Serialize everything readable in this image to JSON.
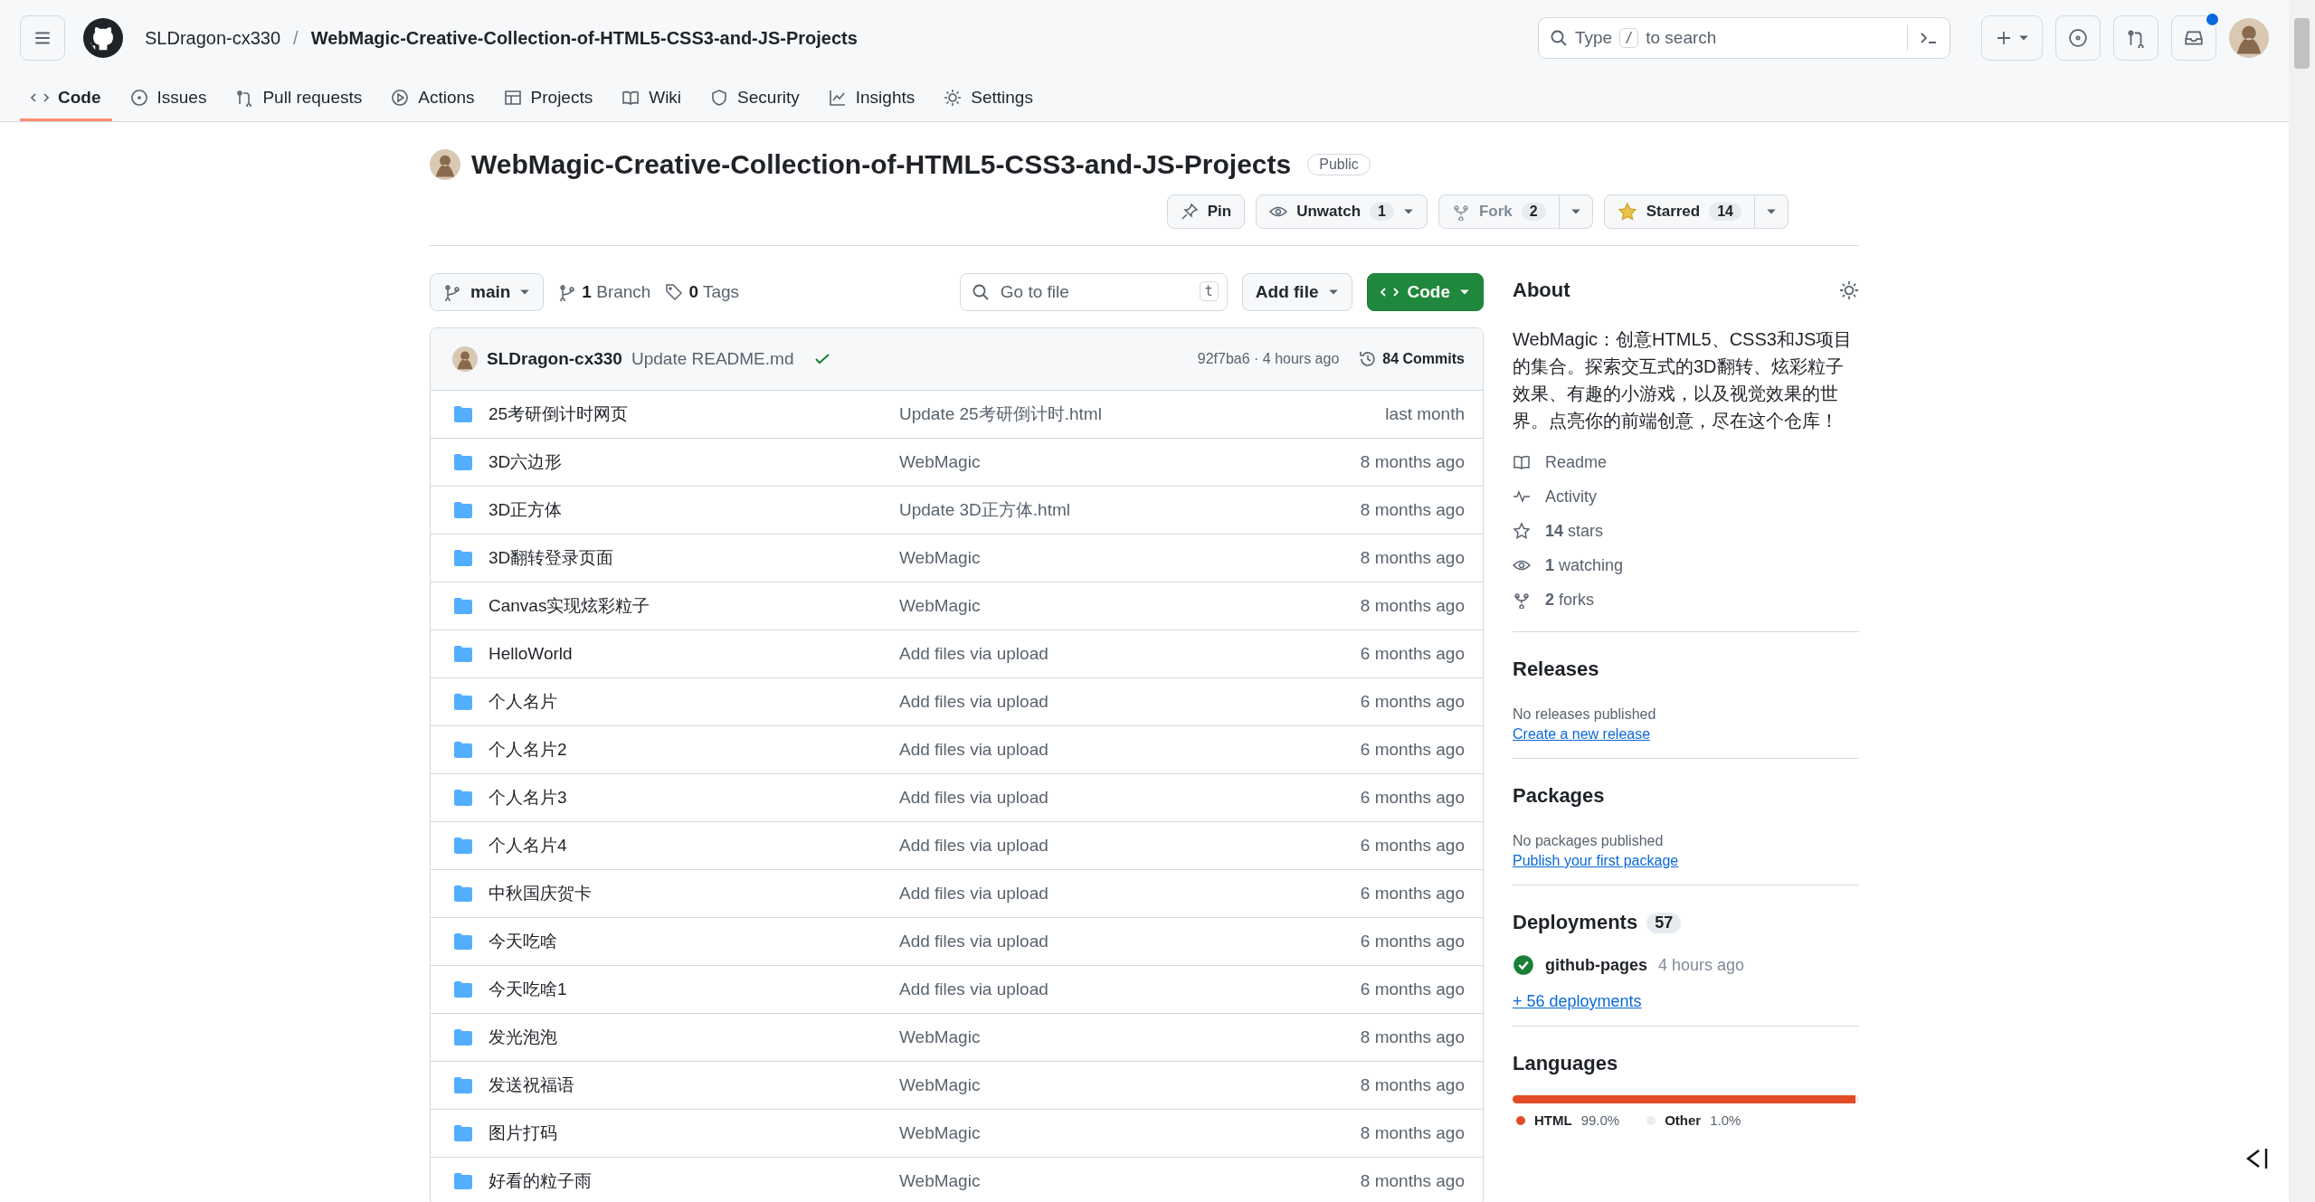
{
  "header": {
    "owner": "SLDragon-cx330",
    "separator": "/",
    "repo": "WebMagic-Creative-Collection-of-HTML5-CSS3-and-JS-Projects",
    "search": {
      "before": "Type",
      "key": "/",
      "after": "to search"
    },
    "inbox_unread": true
  },
  "tabs": [
    {
      "label": "Code",
      "selected": true
    },
    {
      "label": "Issues",
      "selected": false
    },
    {
      "label": "Pull requests",
      "selected": false
    },
    {
      "label": "Actions",
      "selected": false
    },
    {
      "label": "Projects",
      "selected": false
    },
    {
      "label": "Wiki",
      "selected": false
    },
    {
      "label": "Security",
      "selected": false
    },
    {
      "label": "Insights",
      "selected": false
    },
    {
      "label": "Settings",
      "selected": false
    }
  ],
  "repo": {
    "name": "WebMagic-Creative-Collection-of-HTML5-CSS3-and-JS-Projects",
    "visibility": "Public",
    "pin": {
      "label": "Pin"
    },
    "watch": {
      "label": "Unwatch",
      "count": "1"
    },
    "fork": {
      "label": "Fork",
      "count": "2",
      "disabled": true
    },
    "star": {
      "label": "Starred",
      "count": "14",
      "starred": true
    }
  },
  "branch_bar": {
    "branch": "main",
    "branches": "**1** Branch",
    "tags": "**0** Tags",
    "go_to_file": {
      "placeholder": "Go to file",
      "key": "t"
    },
    "add_file": "Add file",
    "code": "Code"
  },
  "commit": {
    "author": "SLDragon-cx330",
    "message": "Update README.md",
    "passed": true,
    "hash_time": "92f7ba6 · 4 hours ago",
    "commits": "84 Commits"
  },
  "files": [
    {
      "name": "25考研倒计时网页",
      "message": "Update 25考研倒计时.html",
      "time": "last month"
    },
    {
      "name": "3D六边形",
      "message": "WebMagic",
      "time": "8 months ago"
    },
    {
      "name": "3D正方体",
      "message": "Update 3D正方体.html",
      "time": "8 months ago"
    },
    {
      "name": "3D翻转登录页面",
      "message": "WebMagic",
      "time": "8 months ago"
    },
    {
      "name": "Canvas实现炫彩粒子",
      "message": "WebMagic",
      "time": "8 months ago"
    },
    {
      "name": "HelloWorld",
      "message": "Add files via upload",
      "time": "6 months ago"
    },
    {
      "name": "个人名片",
      "message": "Add files via upload",
      "time": "6 months ago"
    },
    {
      "name": "个人名片2",
      "message": "Add files via upload",
      "time": "6 months ago"
    },
    {
      "name": "个人名片3",
      "message": "Add files via upload",
      "time": "6 months ago"
    },
    {
      "name": "个人名片4",
      "message": "Add files via upload",
      "time": "6 months ago"
    },
    {
      "name": "中秋国庆贺卡",
      "message": "Add files via upload",
      "time": "6 months ago"
    },
    {
      "name": "今天吃啥",
      "message": "Add files via upload",
      "time": "6 months ago"
    },
    {
      "name": "今天吃啥1",
      "message": "Add files via upload",
      "time": "6 months ago"
    },
    {
      "name": "发光泡泡",
      "message": "WebMagic",
      "time": "8 months ago"
    },
    {
      "name": "发送祝福语",
      "message": "WebMagic",
      "time": "8 months ago"
    },
    {
      "name": "图片打码",
      "message": "WebMagic",
      "time": "8 months ago"
    },
    {
      "name": "好看的粒子雨",
      "message": "WebMagic",
      "time": "8 months ago"
    }
  ],
  "about": {
    "title": "About",
    "description": "WebMagic：创意HTML5、CSS3和JS项目的集合。探索交互式的3D翻转、炫彩粒子效果、有趣的小游戏，以及视觉效果的世界。点亮你的前端创意，尽在这个仓库！",
    "links": [
      "Readme",
      "Activity",
      "**14** stars",
      "**1** watching",
      "**2** forks"
    ]
  },
  "releases": {
    "title": "Releases",
    "note": "No releases published",
    "link": "Create a new release"
  },
  "packages": {
    "title": "Packages",
    "note": "No packages published",
    "link": "Publish your first package"
  },
  "deployments": {
    "title": "Deployments",
    "count": "57",
    "items": [
      {
        "name": "github-pages",
        "time": "4 hours ago",
        "passed": true
      }
    ],
    "more": "+ 56 deployments"
  },
  "languages": {
    "title": "Languages",
    "items": [
      {
        "name": "HTML",
        "percent": "99.0%",
        "color": "#e34c26",
        "level": 0.99
      },
      {
        "name": "Other",
        "percent": "1.0%",
        "color": "#ededed",
        "level": 0.01
      }
    ]
  }
}
